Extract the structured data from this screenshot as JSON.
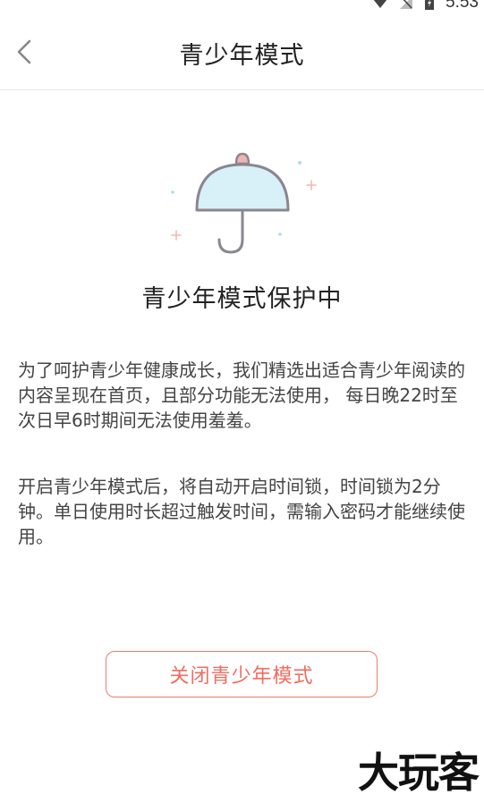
{
  "status_bar": {
    "time": "5:53",
    "icons": [
      "wifi-icon",
      "signal-icon",
      "battery-icon"
    ]
  },
  "header": {
    "title": "青少年模式",
    "back_icon": "chevron-left-icon"
  },
  "illustration": {
    "icon": "umbrella-icon",
    "colors": {
      "canopy": "#d8f0f7",
      "outline": "#8a8690",
      "knob": "#f1b4ae",
      "sparkle_pink": "#f2b9b3",
      "sparkle_teal": "#a9dfe8"
    }
  },
  "main": {
    "heading": "青少年模式保护中",
    "paragraph_1": "为了呵护青少年健康成长，我们精选出适合青少年阅读的内容呈现在首页，且部分功能无法使用， 每日晚22时至次日早6时期间无法使用羞羞。",
    "paragraph_2": "开启青少年模式后，将自动开启时间锁，时间锁为2分钟。单日使用时长超过触发时间，需输入密码才能继续使用。"
  },
  "actions": {
    "close_label": "关闭青少年模式",
    "accent_color": "#ef6d60"
  },
  "watermark": {
    "text": "大玩客"
  }
}
